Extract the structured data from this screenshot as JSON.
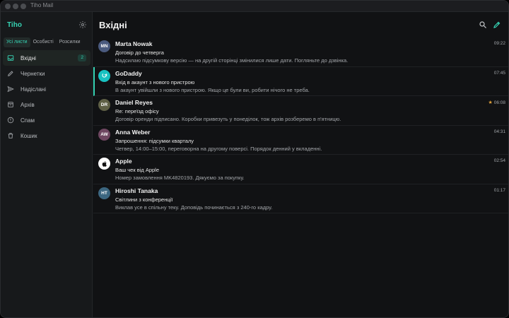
{
  "window": {
    "title": "Tiho Mail"
  },
  "sidebar": {
    "app_name": "Tiho",
    "filters": [
      "Усі листи",
      "Особисті",
      "Розсилки"
    ],
    "folders": [
      {
        "label": "Вхідні",
        "icon": "inbox-icon",
        "badge": "2"
      },
      {
        "label": "Чернетки",
        "icon": "pencil-icon"
      },
      {
        "label": "Надіслані",
        "icon": "send-icon"
      },
      {
        "label": "Архів",
        "icon": "archive-icon"
      },
      {
        "label": "Спам",
        "icon": "alert-icon"
      },
      {
        "label": "Кошик",
        "icon": "trash-icon"
      }
    ]
  },
  "main": {
    "title": "Вхідні"
  },
  "messages": [
    {
      "initials": "MN",
      "avatar_color": "#4a5a7e",
      "sender": "Marta Nowak",
      "time": "09:22",
      "subject": "Договір до четверга",
      "preview": "Надсилаю підсумкову версію — на другій сторінці змінилися лише дати. Погляньте до дзвінка."
    },
    {
      "initials": "",
      "avatar_color": "#19c2c1",
      "sender": "GoDaddy",
      "time": "07:45",
      "subject": "Вхід в акаунт з нового пристрою",
      "preview": "В акаунт увійшли з нового пристрою. Якщо це були ви, робити нічого не треба."
    },
    {
      "initials": "DR",
      "avatar_color": "#5e5f45",
      "sender": "Daniel Reyes",
      "time": "06:08",
      "starred": true,
      "subject": "Re: переїзд офісу",
      "preview": "Договір оренди підписано. Коробки привезуть у понеділок, тож архів розберемо в п'ятницю."
    },
    {
      "initials": "AW",
      "avatar_color": "#6e4660",
      "sender": "Anna Weber",
      "time": "04:31",
      "subject": "Запрошення: підсумки кварталу",
      "preview": "Четвер, 14:00–15:00, переговорна на другому поверсі. Порядок денний у вкладенні."
    },
    {
      "initials": "",
      "avatar_color": "#ffffff",
      "sender": "Apple",
      "time": "02:54",
      "subject": "Ваш чек від Apple",
      "preview": "Номер замовлення MK4820193. Дякуємо за покупку."
    },
    {
      "initials": "HT",
      "avatar_color": "#3c6680",
      "sender": "Hiroshi Tanaka",
      "time": "01:17",
      "subject": "Світлини з конференції",
      "preview": "Виклав усе в спільну теку. Доповідь починається з 240-го кадру."
    }
  ],
  "colors": {
    "accent": "#36d3b4",
    "star": "#e0a13b"
  }
}
